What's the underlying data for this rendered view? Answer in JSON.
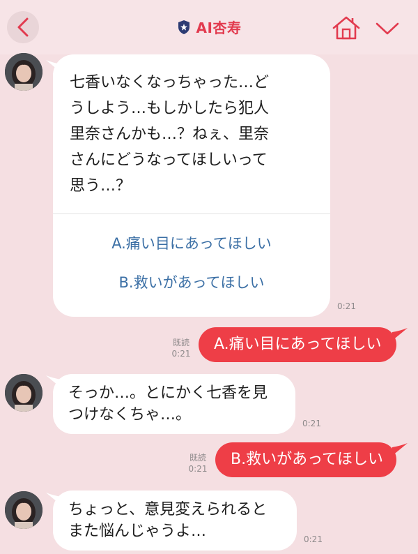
{
  "header": {
    "title": "AI杏寿",
    "colors": {
      "accent": "#e23b4f",
      "background": "#f7e4e7"
    },
    "icons": [
      "back-chevron-icon",
      "shield-star-icon",
      "home-icon",
      "chevron-down-icon"
    ]
  },
  "messages": [
    {
      "type": "incoming-choice",
      "text": "七香いなくなっちゃった…ど\nうしよう…もしかしたら犯人\n里奈さんかも…？ねぇ、里奈\nさんにどうなってほしいって\n思う…？",
      "options": [
        "A.痛い目にあってほしい",
        "B.救いがあってほしい"
      ],
      "time": "0:21"
    },
    {
      "type": "outgoing",
      "text": "A.痛い目にあってほしい",
      "read_label": "既読",
      "time": "0:21"
    },
    {
      "type": "incoming",
      "text": "そっか…。とにかく七香を見\nつけなくちゃ…。",
      "time": "0:21"
    },
    {
      "type": "outgoing",
      "text": "B.救いがあってほしい",
      "read_label": "既読",
      "time": "0:21"
    },
    {
      "type": "incoming",
      "text": "ちょっと、意見変えられると\nまた悩んじゃうよ…",
      "time": "0:21"
    }
  ],
  "colors": {
    "chat_background": "#f5dfe2",
    "outgoing_bubble": "#ee3e47",
    "incoming_bubble": "#ffffff",
    "option_text": "#3b6fa5"
  }
}
